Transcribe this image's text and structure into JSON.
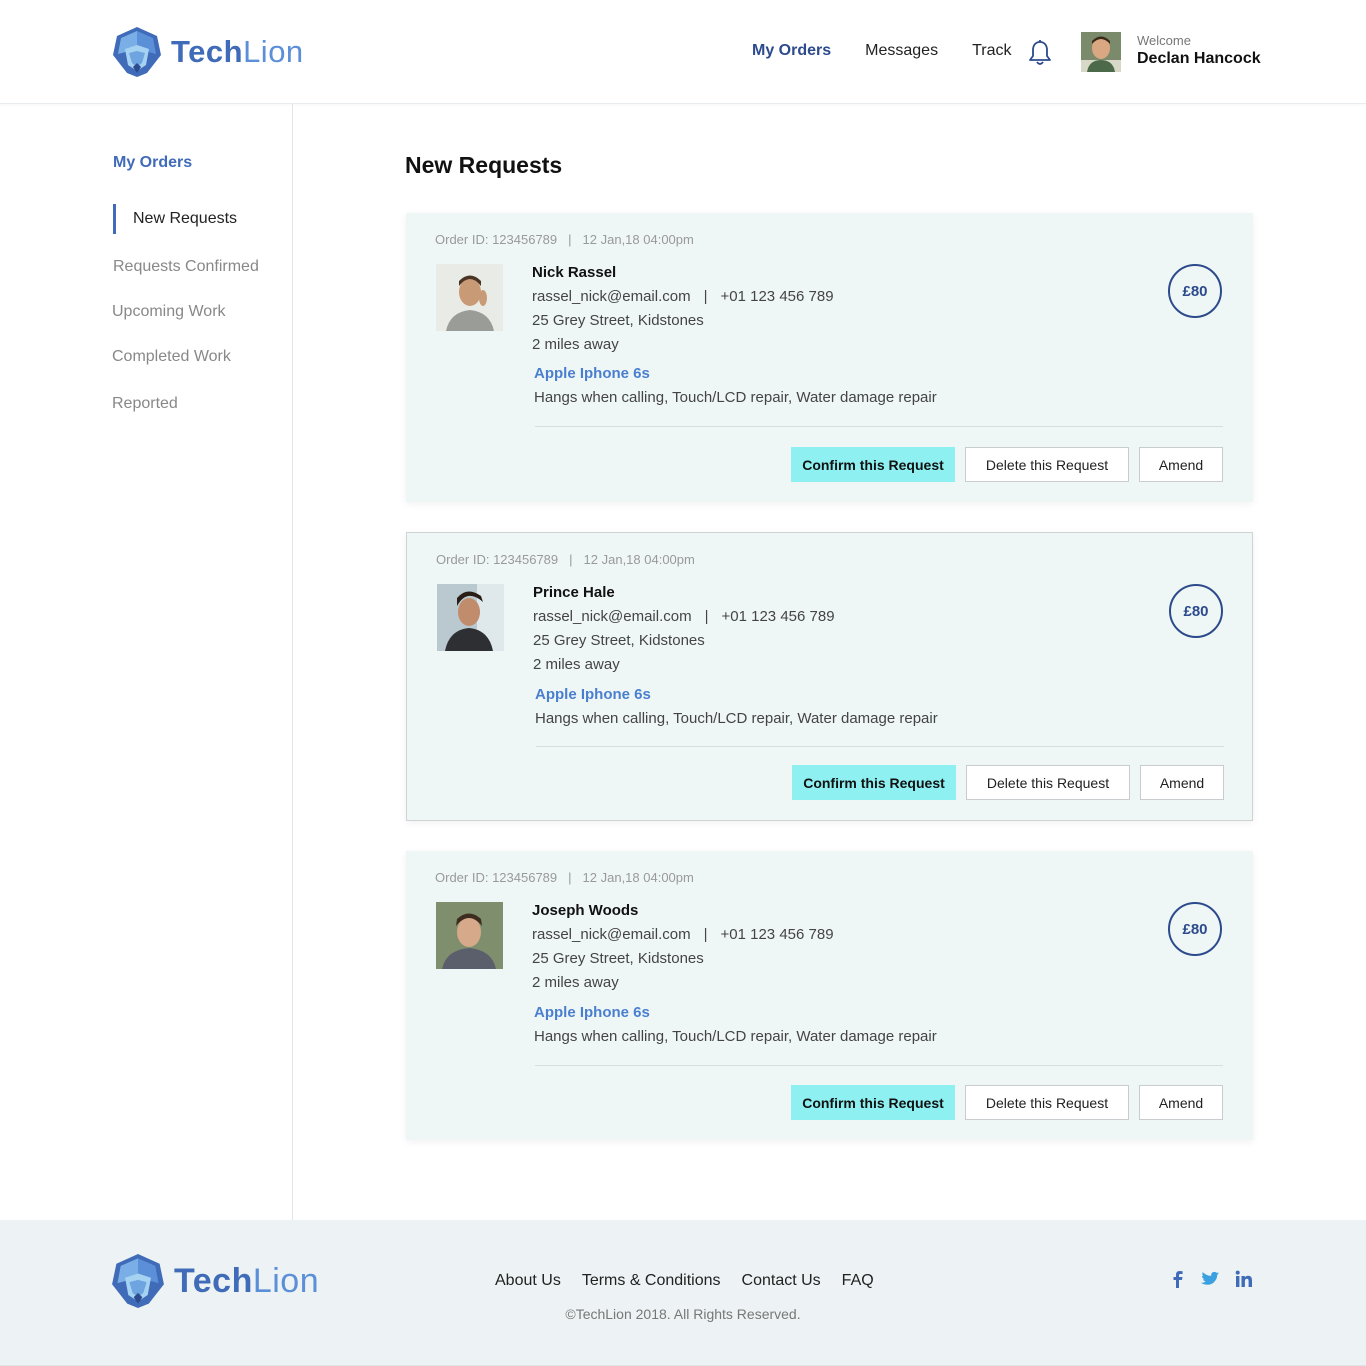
{
  "brand": {
    "name_part1": "Tech",
    "name_part2": "Lion"
  },
  "nav": {
    "items": [
      {
        "label": "My Orders",
        "active": true
      },
      {
        "label": "Messages",
        "active": false
      },
      {
        "label": "Track",
        "active": false
      }
    ],
    "bell_icon": "bell-icon"
  },
  "user": {
    "welcome": "Welcome",
    "name": "Declan Hancock"
  },
  "sidebar": {
    "title": "My Orders",
    "items": [
      {
        "label": "New Requests",
        "active": true
      },
      {
        "label": "Requests Confirmed",
        "active": false
      },
      {
        "label": "Upcoming Work",
        "active": false
      },
      {
        "label": "Completed Work",
        "active": false
      },
      {
        "label": "Reported",
        "active": false
      }
    ]
  },
  "main": {
    "title": "New Requests",
    "orders": [
      {
        "order_id": "Order ID: 123456789",
        "datetime": "12 Jan,18 04:00pm",
        "customer": "Nick Rassel",
        "email": "rassel_nick@email.com",
        "phone": "+01 123 456 789",
        "address": "25 Grey Street, Kidstones",
        "distance": "2 miles away",
        "device": "Apple Iphone 6s",
        "issues": "Hangs when calling, Touch/LCD repair, Water damage repair",
        "price": "£80",
        "confirm_label": "Confirm this Request",
        "delete_label": "Delete this Request",
        "amend_label": "Amend"
      },
      {
        "order_id": "Order ID: 123456789",
        "datetime": "12 Jan,18 04:00pm",
        "customer": "Prince Hale",
        "email": "rassel_nick@email.com",
        "phone": "+01 123 456 789",
        "address": "25 Grey Street, Kidstones",
        "distance": "2 miles away",
        "device": "Apple Iphone 6s",
        "issues": "Hangs when calling, Touch/LCD repair, Water damage repair",
        "price": "£80",
        "confirm_label": "Confirm this Request",
        "delete_label": "Delete this Request",
        "amend_label": "Amend"
      },
      {
        "order_id": "Order ID: 123456789",
        "datetime": "12 Jan,18 04:00pm",
        "customer": "Joseph Woods",
        "email": "rassel_nick@email.com",
        "phone": "+01 123 456 789",
        "address": "25 Grey Street, Kidstones",
        "distance": "2 miles away",
        "device": "Apple Iphone 6s",
        "issues": "Hangs when calling, Touch/LCD repair, Water damage repair",
        "price": "£80",
        "confirm_label": "Confirm this Request",
        "delete_label": "Delete this Request",
        "amend_label": "Amend"
      }
    ]
  },
  "footer": {
    "links": [
      "About Us",
      "Terms & Conditions",
      "Contact Us",
      "FAQ"
    ],
    "copyright": "©TechLion 2018. All Rights Reserved.",
    "social": [
      "facebook-icon",
      "twitter-icon",
      "linkedin-icon"
    ]
  },
  "colors": {
    "brand_primary": "#3f6bb8",
    "brand_secondary": "#5b8fd8",
    "nav_active": "#2c4a8c",
    "card_bg": "#eff7f6",
    "confirm_bg": "#8ef0f1",
    "device_link": "#4a7fcf"
  }
}
